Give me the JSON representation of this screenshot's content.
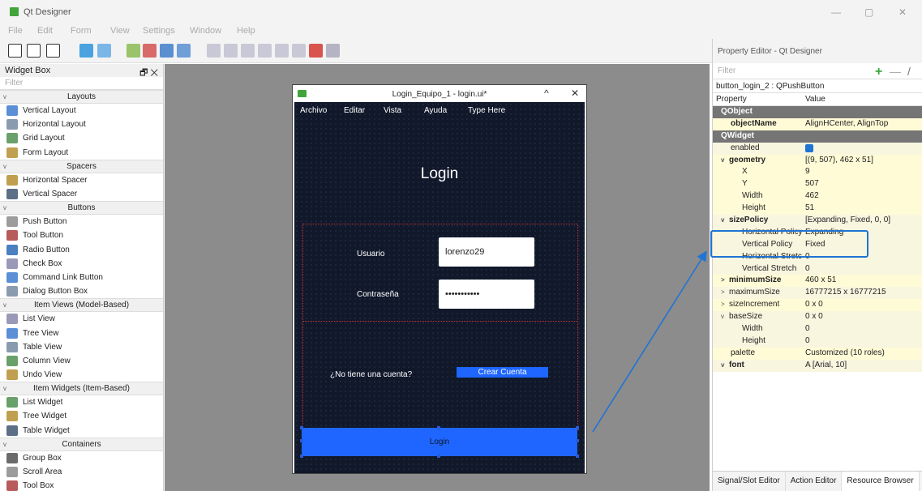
{
  "app": {
    "title": "Qt Designer",
    "window_controls": [
      "—",
      "▢",
      "✕"
    ]
  },
  "menubar": [
    "File",
    "Edit",
    "Form",
    "View",
    "Settings",
    "Window",
    "Help"
  ],
  "widget_box": {
    "title": "Widget Box",
    "title_controls": "🗗 ✕",
    "filter_placeholder": "Filter",
    "sections": [
      {
        "category": "Layouts",
        "items": [
          "Vertical Layout",
          "Horizontal Layout",
          "Grid Layout",
          "Form Layout"
        ]
      },
      {
        "category": "Spacers",
        "items": [
          "Horizontal Spacer",
          "Vertical Spacer"
        ]
      },
      {
        "category": "Buttons",
        "items": [
          "Push Button",
          "Tool Button",
          "Radio Button",
          "Check Box",
          "Command Link Button",
          "Dialog Button Box"
        ]
      },
      {
        "category": "Item Views (Model-Based)",
        "items": [
          "List View",
          "Tree View",
          "Table View",
          "Column View",
          "Undo View"
        ]
      },
      {
        "category": "Item Widgets (Item-Based)",
        "items": [
          "List Widget",
          "Tree Widget",
          "Table Widget"
        ]
      },
      {
        "category": "Containers",
        "items": [
          "Group Box",
          "Scroll Area",
          "Tool Box"
        ]
      }
    ]
  },
  "form_window": {
    "title": "Login_Equipo_1 - login.ui*",
    "controls": [
      "^",
      "✕"
    ],
    "menu": [
      "Archivo",
      "Editar",
      "Vista",
      "Ayuda",
      "Type Here"
    ],
    "heading": "Login",
    "usuario_label": "Usuario",
    "usuario_value": "lorenzo29",
    "password_label": "Contraseña",
    "password_value": "•••••••••••",
    "no_account_text": "¿No tiene una cuenta?",
    "create_account_button": "Crear Cuenta",
    "login_button": "Login"
  },
  "property_editor": {
    "title": "Property Editor - Qt Designer",
    "filter_placeholder": "Filter",
    "object": "button_login_2 : QPushButton",
    "col_property": "Property",
    "col_value": "Value",
    "rows": [
      {
        "name": "QObject",
        "value": "",
        "style": "sec"
      },
      {
        "name": "objectName",
        "value": "AlignHCenter, AlignTop",
        "style": "y bold"
      },
      {
        "name": "QWidget",
        "value": "",
        "style": "sec"
      },
      {
        "name": "enabled",
        "value": "",
        "style": "g",
        "check": true
      },
      {
        "name": "geometry",
        "value": "[(9, 507), 462 x 51]",
        "style": "y bold",
        "exp": "v"
      },
      {
        "name": "X",
        "value": "9",
        "style": "y sub"
      },
      {
        "name": "Y",
        "value": "507",
        "style": "y sub"
      },
      {
        "name": "Width",
        "value": "462",
        "style": "y sub"
      },
      {
        "name": "Height",
        "value": "51",
        "style": "y sub"
      },
      {
        "name": "sizePolicy",
        "value": "[Expanding, Fixed, 0, 0]",
        "style": "g bold",
        "exp": "v"
      },
      {
        "name": "Horizontal Policy",
        "value": "Expanding",
        "style": "g sub"
      },
      {
        "name": "Vertical Policy",
        "value": "Fixed",
        "style": "g sub"
      },
      {
        "name": "Horizontal Stretch",
        "value": "0",
        "style": "g sub"
      },
      {
        "name": "Vertical Stretch",
        "value": "0",
        "style": "g sub"
      },
      {
        "name": "minimumSize",
        "value": "460 x 51",
        "style": "y bold",
        "exp": ">"
      },
      {
        "name": "maximumSize",
        "value": "16777215 x 16777215",
        "style": "g",
        "exp": ">"
      },
      {
        "name": "sizeIncrement",
        "value": "0 x 0",
        "style": "y",
        "exp": ">"
      },
      {
        "name": "baseSize",
        "value": "0 x 0",
        "style": "g",
        "exp": "v"
      },
      {
        "name": "Width",
        "value": "0",
        "style": "g sub"
      },
      {
        "name": "Height",
        "value": "0",
        "style": "g sub"
      },
      {
        "name": "palette",
        "value": "Customized (10 roles)",
        "style": "y"
      },
      {
        "name": "font",
        "value": "A  [Arial, 10]",
        "style": "g bold",
        "exp": "v"
      }
    ],
    "tabs": [
      "Signal/Slot Editor",
      "Action Editor",
      "Resource Browser"
    ]
  },
  "colors": {
    "accent": "#1e66ff",
    "form_bg": "#10182a",
    "highlight": "#1f74d4"
  }
}
